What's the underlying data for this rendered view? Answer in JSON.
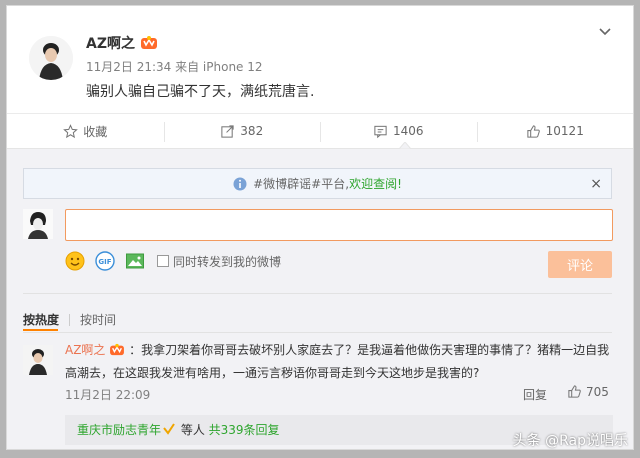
{
  "post": {
    "username": "AZ啊之",
    "meta": "11月2日 21:34 来自 iPhone 12",
    "text": "骗别人骗自己骗不了天，满纸荒唐言."
  },
  "actions": {
    "favorite_label": "收藏",
    "repost_count": "382",
    "comment_count": "1406",
    "like_count": "10121"
  },
  "notice": {
    "prefix": "#微博辟谣#平台,",
    "link": "欢迎查阅!",
    "close": "×"
  },
  "composer": {
    "input_value": "",
    "repost_label": "同时转发到我的微博",
    "submit_label": "评论",
    "submit_color": "#fbc09a"
  },
  "sort": {
    "hot_label": "按热度",
    "time_label": "按时间",
    "accent": "#ff8200"
  },
  "comment": {
    "username": "AZ啊之",
    "text": "：我拿刀架着你哥哥去破坏别人家庭去了？是我逼着他做伤天害理的事情了？猪精一边自我高潮去，在这跟我发泄有啥用，一通污言秽语你哥哥走到今天这地步是我害的?",
    "time": "11月2日 22:09",
    "reply_label": "回复",
    "like_count": "705",
    "reply_summary_user": "重庆市励志青年",
    "reply_summary_mid": " 等人 ",
    "reply_summary_count": "共339条回复"
  },
  "watermark": "头条 @Rap说唱乐"
}
